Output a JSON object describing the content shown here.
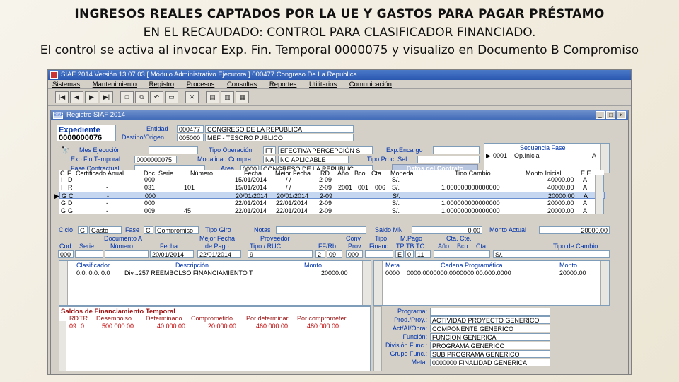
{
  "slide": {
    "title": "INGRESOS REALES CAPTADOS POR LA UE Y GASTOS PARA PAGAR PRÉSTAMO",
    "subtitle": "EN EL RECAUDADO: CONTROL PARA CLASIFICADOR FINANCIADO.",
    "note": "El control se activa al invocar Exp. Fin. Temporal 0000075 y visualizo en Documento B Compromiso"
  },
  "app": {
    "title": "SIAF 2014    Versión 13.07.03    [ Módulo Administrativo    Ejecutora ] 000477 Congreso De La Republica",
    "menu": [
      "Sistemas",
      "Mantenimiento",
      "Registro",
      "Procesos",
      "Consultas",
      "Reportes",
      "Utilitarios",
      "Comunicación"
    ],
    "toolbar": [
      "|◀",
      "◀",
      "▶",
      "▶|",
      "□",
      "⧉",
      "↶",
      "▭",
      "✕",
      "▤",
      "▥",
      "▦"
    ]
  },
  "window": {
    "title": "Registro SIAF 2014",
    "badge": "SIAF",
    "expediente_label": "Expediente",
    "expediente_value": "0000000076",
    "entidad_label": "Entidad",
    "entidad_code": "000477",
    "entidad_name": "CONGRESO DE LA REPUBLICA",
    "destino_label": "Destino/Origen",
    "destino_code": "005000",
    "destino_name": "MEF - TESORO PUBLICO",
    "mes_label": "Mes Ejecución",
    "tipo_op_label": "Tipo Operación",
    "tipo_op_code": "FT",
    "tipo_op_value": "EFECTIVA PERCEPCIÓN S",
    "exp_encargo_label": "Exp.Encargo",
    "exp_fin_label": "Exp.Fin.Temporal",
    "exp_fin_value": "0000000075",
    "modalidad_label": "Modalidad Compra",
    "modalidad_code": "NA",
    "modalidad_value": "NO APLICABLE",
    "tipo_proc_label": "Tipo Proc. Sel.",
    "fase_label": "Fase Contractual",
    "area_label": "Area",
    "area_code": "0000",
    "area_value": "CONGRESO DE LA REPUBLIC",
    "datos_contrato": "Datos del Contrato",
    "secuencia_label": "Secuencia Fase",
    "secuencia_code": "0001",
    "secuencia_value": "Op.Inicial",
    "secuencia_flag": "A"
  },
  "grid": {
    "headers": [
      "C",
      "F",
      "Certificado Anual",
      "Doc. Serie",
      "Número",
      "Fecha",
      "Mejor Fecha",
      "RD",
      "Año",
      "Bco.",
      "Cta.",
      "Moneda",
      "Tipo Cambio",
      "Monto Inicial",
      "E.E."
    ],
    "rows": [
      {
        "c": "I",
        "f": "D",
        "cert": "",
        "doc": "000",
        "serie": "",
        "num": "",
        "fecha": "15/01/2014",
        "mejor": "/ /",
        "rd": "2-09",
        "anio": "",
        "bco": "",
        "cta": "",
        "mon": "S/.",
        "tc": "",
        "monto": "40000.00",
        "ee": "A"
      },
      {
        "c": "I",
        "f": "R",
        "cert": "-",
        "doc": "031",
        "serie": "101",
        "num": "",
        "fecha": "15/01/2014",
        "mejor": "/ /",
        "rd": "2-09",
        "anio": "2001",
        "bco": "001",
        "cta": "006",
        "mon": "S/.",
        "tc": "1.000000000000000",
        "monto": "40000.00",
        "ee": "A"
      },
      {
        "c": "G",
        "f": "C",
        "cert": "-",
        "doc": "000",
        "serie": "",
        "num": "",
        "fecha": "20/01/2014",
        "mejor": "20/01/2014",
        "rd": "2-09",
        "anio": "",
        "bco": "",
        "cta": "",
        "mon": "S/.",
        "tc": "",
        "monto": "20000.00",
        "ee": "A"
      },
      {
        "c": "G",
        "f": "D",
        "cert": "-",
        "doc": "000",
        "serie": "",
        "num": "",
        "fecha": "22/01/2014",
        "mejor": "22/01/2014",
        "rd": "2-09",
        "anio": "",
        "bco": "",
        "cta": "",
        "mon": "S/.",
        "tc": "1.000000000000000",
        "monto": "20000.00",
        "ee": "A"
      },
      {
        "c": "G",
        "f": "G",
        "cert": "-",
        "doc": "009",
        "serie": "45",
        "num": "",
        "fecha": "22/01/2014",
        "mejor": "22/01/2014",
        "rd": "2-09",
        "anio": "",
        "bco": "",
        "cta": "",
        "mon": "S/.",
        "tc": "1.000000000000000",
        "monto": "20000.00",
        "ee": "A"
      }
    ]
  },
  "ciclo": {
    "ciclo_label": "Ciclo",
    "ciclo_code": "G",
    "ciclo_value": "Gasto",
    "fase_label": "Fase",
    "fase_code": "C",
    "fase_value": "Compromiso",
    "tipo_giro_label": "Tipo Giro",
    "notas_label": "Notas",
    "saldo_label": "Saldo MN",
    "saldo_value": "0.00",
    "monto_actual_label": "Monto Actual",
    "monto_actual_value": "20000.00"
  },
  "documento": {
    "cod_label": "Cod.",
    "serie_label": "Serie",
    "documento_label": "Documento A",
    "numero_label": "Número",
    "fecha_label": "Fecha",
    "mejor_fecha_label": "Mejor Fecha",
    "de_pago_label": "de Pago",
    "proveedor_label": "Proveedor",
    "tipo_ruc_label": "Tipo / RUC",
    "ff_label": "FF/Rb",
    "conv_label": "Conv",
    "prov_label": "Prov",
    "tipo_label": "Tipo",
    "financ_label": "Financ",
    "m_pago_label": "M.Pago",
    "tp_label": "TP",
    "tb_label": "TB",
    "tc_label": "TC",
    "cta_cte_label": "Cta. Cte.",
    "ano_label": "Año",
    "bco_label": "Bco",
    "cta_label": "Cta",
    "tipo_cambio_label": "Tipo de Cambio",
    "cod": "000",
    "fecha": "20/01/2014",
    "mejor_fecha": "22/01/2014",
    "tipo": "9",
    "ff": "2",
    "rb": "09",
    "conv": "000",
    "tp": "E",
    "tb": "0",
    "tc": "11",
    "moneda": "S/."
  },
  "clasificador": {
    "label": "Clasificador",
    "desc_label": "Descripción",
    "monto_label": "Monto",
    "code": "0.0. 0.0. 0.0",
    "desc": "Div...257 REEMBOLSO FINANCIAMIENTO T",
    "monto": "20000.00"
  },
  "meta": {
    "meta_label": "Meta",
    "cadena_label": "Cadena Programática",
    "monto_label": "Monto",
    "meta": "0000",
    "cadena": "0000.0000000.0000000.00.000.0000",
    "monto": "20000.00"
  },
  "saldos": {
    "title": "Saldos de Financiamiento Temporal",
    "headers": [
      "RD",
      "TR",
      "Desembolso",
      "Determinado",
      "Comprometido",
      "Por determinar",
      "Por comprometer"
    ],
    "row": {
      "rd": "09",
      "tr": "0",
      "desembolso": "500.000.00",
      "determinado": "40.000.00",
      "comprometido": "20.000.00",
      "por_determinar": "460.000.00",
      "por_comprometer": "480.000.00"
    }
  },
  "programa": {
    "rows": [
      {
        "label": "Programa:",
        "value": ""
      },
      {
        "label": "Prod./Proy.:",
        "value": "ACTIVIDAD PROYECTO GENERICO"
      },
      {
        "label": "Act/AI/Obra:",
        "value": "COMPONENTE GENERICO"
      },
      {
        "label": "Función:",
        "value": "FUNCION GENERICA"
      },
      {
        "label": "División Func.:",
        "value": "PROGRAMA GENERICO"
      },
      {
        "label": "Grupo Func.:",
        "value": "SUB PROGRAMA GENERICO"
      },
      {
        "label": "Meta:",
        "value": "0000000 FINALIDAD GENERICA"
      }
    ]
  }
}
